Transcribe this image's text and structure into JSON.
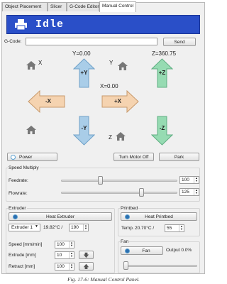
{
  "tabs": [
    {
      "label": "Object Placement"
    },
    {
      "label": "Slicer"
    },
    {
      "label": "G-Code Editor"
    },
    {
      "label": "Manual Control"
    }
  ],
  "status": {
    "text": "Idle"
  },
  "gcode": {
    "label": "G-Code:",
    "value": "",
    "send_label": "Send"
  },
  "coords": {
    "y": "Y=0.00",
    "z": "Z=360.75",
    "x": "X=0.00"
  },
  "axis_labels": {
    "x": "X",
    "y": "Y",
    "z": "Z"
  },
  "arrows": {
    "up_y": "+Y",
    "down_y": "-Y",
    "left_x": "-X",
    "right_x": "+X",
    "up_z": "+Z",
    "down_z": "-Z"
  },
  "buttons": {
    "power": "Power",
    "motor_off": "Turn Motor Off",
    "park": "Park"
  },
  "speed": {
    "title": "Speed Multiply",
    "feedrate_label": "Feedrate:",
    "feedrate_value": "100",
    "flowrate_label": "Flowrate:",
    "flowrate_value": "125",
    "feedrate_fraction": 0.33,
    "flowrate_fraction": 0.7
  },
  "extruder": {
    "title": "Extruder",
    "heat_label": "Heat Extruder",
    "select_value": "Extruder 1",
    "temp_reading": "19.82°C /",
    "temp_target": "190",
    "speed_label": "Speed [mm/min]",
    "speed_value": "100",
    "extrude_label": "Extrude [mm]",
    "extrude_value": "10",
    "retract_label": "Retract [mm]",
    "retract_value": "100"
  },
  "printbed": {
    "title": "Printbed",
    "heat_label": "Heat Printbed",
    "temp_label": "Temp.",
    "temp_reading": "20.70°C /",
    "temp_target": "55"
  },
  "fan": {
    "title": "Fan",
    "button_label": "Fan",
    "output_label": "Output 0.0%",
    "level_fraction": 0.0
  },
  "caption": "Fig. 17-6: Manual Control Panel.",
  "colors": {
    "status_bg": "#2a4fc8",
    "arrow_blue": "#a9cde8",
    "arrow_green": "#96dbb2",
    "arrow_orange": "#f5d3b0"
  }
}
